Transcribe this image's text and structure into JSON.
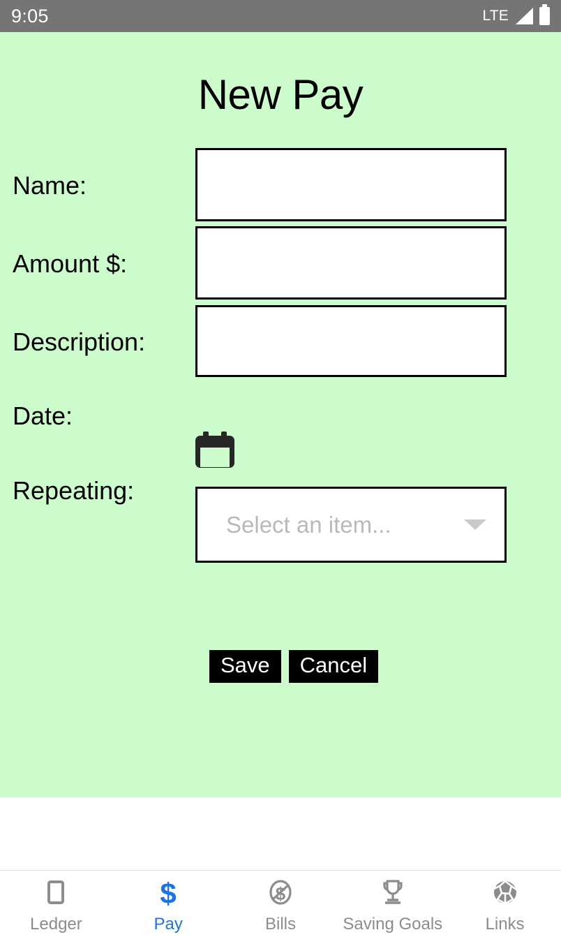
{
  "status_bar": {
    "time": "9:05",
    "network": "LTE",
    "signal_icon": "signal-bars-icon",
    "battery_icon": "battery-full-icon",
    "background_color": "#757575"
  },
  "screen": {
    "title": "New Pay",
    "background_color": "#ccfccc",
    "text_color": "#000000"
  },
  "form": {
    "fields": [
      {
        "label": "Name:",
        "value": "",
        "placeholder": "",
        "type": "text"
      },
      {
        "label": "Amount $:",
        "value": "",
        "placeholder": "",
        "type": "text"
      },
      {
        "label": "Description:",
        "value": "",
        "placeholder": "",
        "type": "text"
      },
      {
        "label": "Date:",
        "value": "",
        "placeholder": "",
        "type": "date-picker",
        "icon": "calendar-icon"
      },
      {
        "label": "Repeating:",
        "value": "",
        "placeholder": "Select an item...",
        "type": "select",
        "icon": "chevron-down-icon"
      }
    ],
    "select_placeholder": "Select an item...",
    "placeholder_color": "#b9b9b9"
  },
  "actions": {
    "save_label": "Save",
    "cancel_label": "Cancel",
    "button_background": "#000000",
    "button_text_color": "#ffffff"
  },
  "bottom_nav": {
    "active_color": "#1a73e8",
    "inactive_color": "#8c8c8c",
    "items": [
      {
        "label": "Ledger",
        "icon": "book-icon",
        "active": false
      },
      {
        "label": "Pay",
        "icon": "dollar-sign-icon",
        "active": true
      },
      {
        "label": "Bills",
        "icon": "money-off-icon",
        "active": false
      },
      {
        "label": "Saving Goals",
        "icon": "trophy-icon",
        "active": false
      },
      {
        "label": "Links",
        "icon": "globe-icon",
        "active": false
      }
    ]
  }
}
